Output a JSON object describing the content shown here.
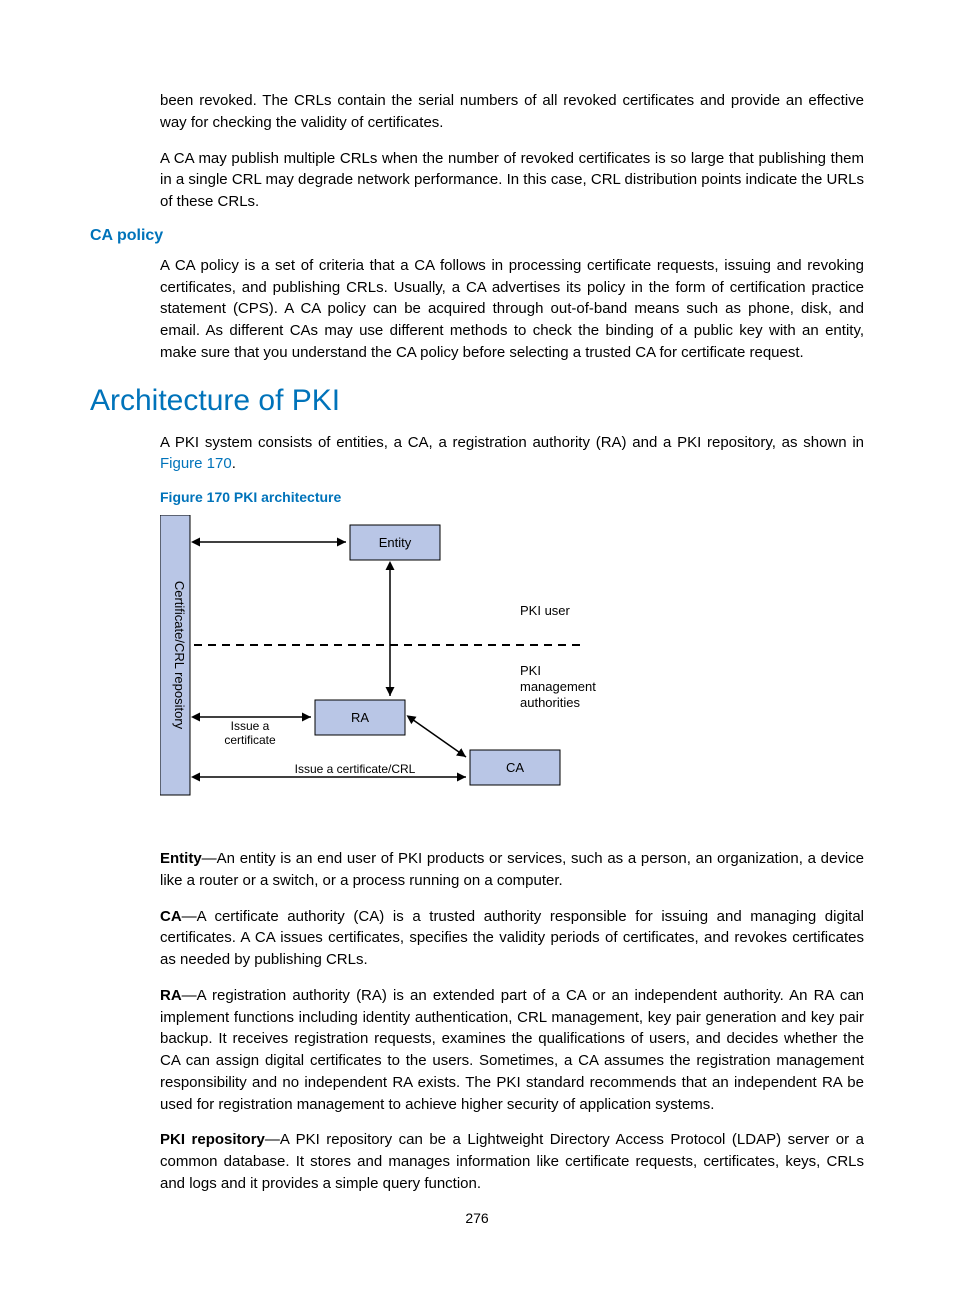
{
  "intro": {
    "p1": "been revoked. The CRLs contain the serial numbers of all revoked certificates and provide an effective way for checking the validity of certificates.",
    "p2": "A CA may publish multiple CRLs when the number of revoked certificates is so large that publishing them in a single CRL may degrade network performance. In this case, CRL distribution points indicate the URLs of these CRLs."
  },
  "ca_policy": {
    "heading": "CA policy",
    "p1": "A CA policy is a set of criteria that a CA follows in processing certificate requests, issuing and revoking certificates, and publishing CRLs. Usually, a CA advertises its policy in the form of certification practice statement (CPS). A CA policy can be acquired through out-of-band means such as phone, disk, and email. As different CAs may use different methods to check the binding of a public key with an entity, make sure that you understand the CA policy before selecting a trusted CA for certificate request."
  },
  "architecture": {
    "heading": "Architecture of PKI",
    "intro_pre": "A PKI system consists of entities, a CA, a registration authority (RA) and a PKI repository, as shown in ",
    "intro_link": "Figure 170",
    "intro_post": ".",
    "figure_caption": "Figure 170 PKI architecture"
  },
  "diagram": {
    "repo": "Certificate/CRL repository",
    "entity": "Entity",
    "ra": "RA",
    "ca": "CA",
    "pki_user": "PKI user",
    "pki_mgmt_l1": "PKI",
    "pki_mgmt_l2": "management",
    "pki_mgmt_l3": "authorities",
    "issue_cert_l1": "Issue a",
    "issue_cert_l2": "certificate",
    "issue_cert_crl": "Issue a certificate/CRL"
  },
  "defs": {
    "entity_term": "Entity",
    "entity_text": "—An entity is an end user of PKI products or services, such as a person, an organization, a device like a router or a switch, or a process running on a computer.",
    "ca_term": "CA",
    "ca_text": "—A certificate authority (CA) is a trusted authority responsible for issuing and managing digital certificates. A CA issues certificates, specifies the validity periods of certificates, and revokes certificates as needed by publishing CRLs.",
    "ra_term": "RA",
    "ra_text": "—A registration authority (RA) is an extended part of a CA or an independent authority. An RA can implement functions including identity authentication, CRL management, key pair generation and key pair backup. It receives registration requests, examines the qualifications of users, and decides whether the CA can assign digital certificates to the users. Sometimes, a CA assumes the registration management responsibility and no independent RA exists. The PKI standard recommends that an independent RA be used for registration management to achieve higher security of application systems.",
    "repo_term": "PKI repository",
    "repo_text": "—A PKI repository can be a Lightweight Directory Access Protocol (LDAP) server or a common database. It stores and manages information like certificate requests, certificates, keys, CRLs and logs and it provides a simple query function."
  },
  "page_number": "276"
}
